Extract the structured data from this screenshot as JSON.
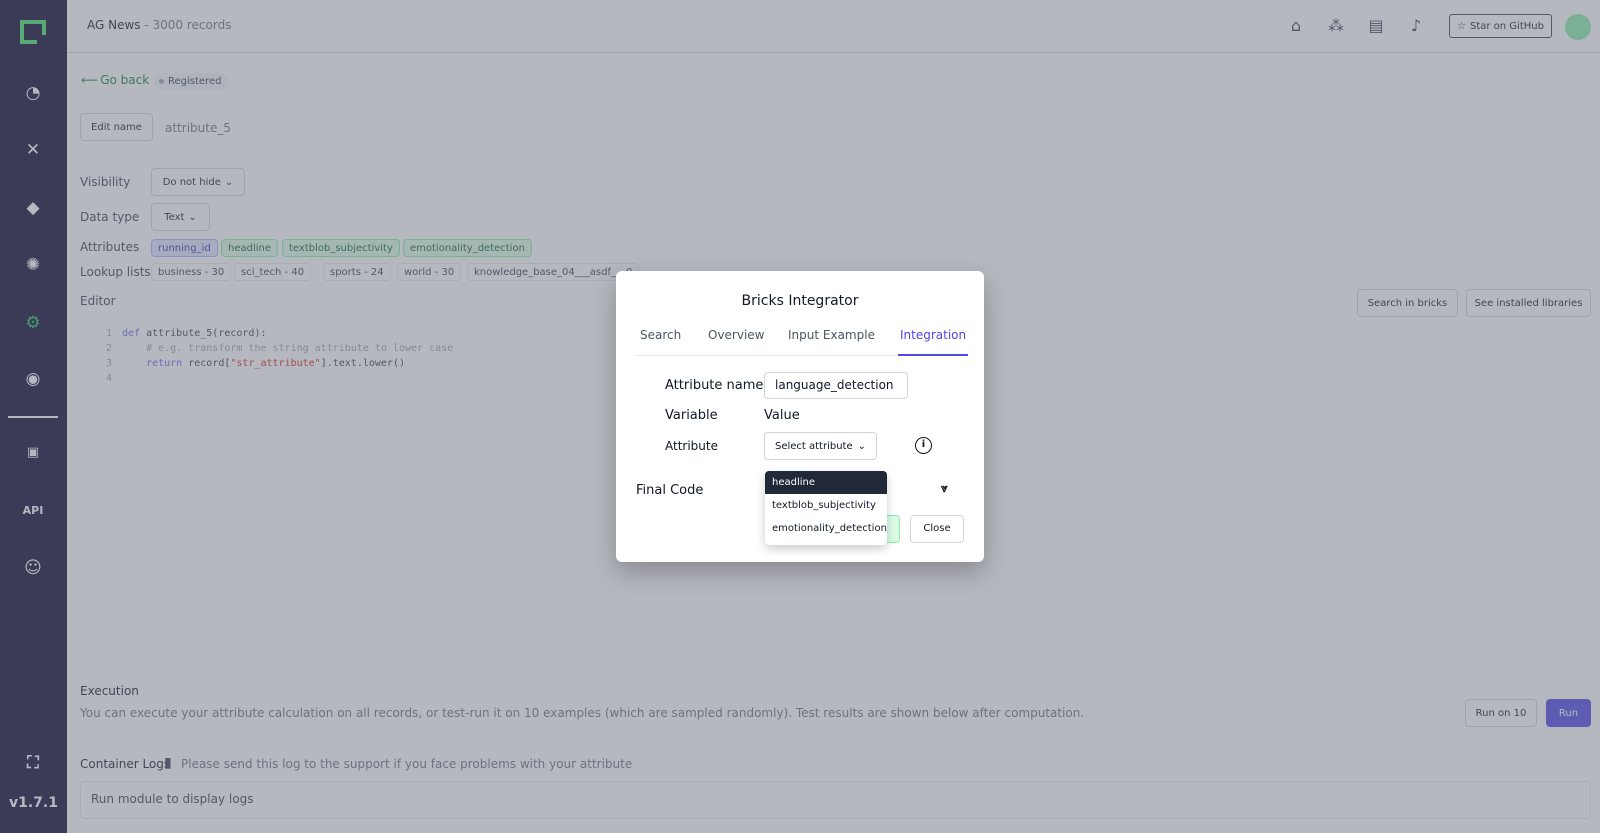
{
  "app": {
    "title": "AG News",
    "subtitle": "- 3000 records",
    "version": "v1.7.1"
  },
  "sidebar": {
    "items": [
      "overview-icon",
      "data-browser-icon",
      "labeling-icon",
      "heuristics-icon",
      "settings-icon",
      "admin-icon",
      "docs-icon",
      "api-icon",
      "discord-icon",
      "fullscreen-icon"
    ]
  },
  "header": {
    "github_label": "Star on GitHub"
  },
  "page": {
    "go_back": "Go back",
    "status": "Registered",
    "edit_name_label": "Edit name",
    "attribute_name": "attribute_5",
    "visibility_label": "Visibility",
    "visibility_value": "Do not hide",
    "data_type_label": "Data type",
    "data_type_value": "Text",
    "attributes_label": "Attributes",
    "attributes": [
      "running_id",
      "headline",
      "textblob_subjectivity",
      "emotionality_detection"
    ],
    "lookup_label": "Lookup lists",
    "lookups": [
      "business - 30",
      "sci_tech - 40",
      "sports - 24",
      "world - 30",
      "knowledge_base_04___asdf_ - 0"
    ],
    "editor_label": "Editor",
    "search_bricks": "Search in bricks",
    "installed_libs": "See installed libraries",
    "code": {
      "l1_kw": "def",
      "l1_rest": " attribute_5(record):",
      "l2": "    # e.g. transform the string attribute to lower case",
      "l3_kw": "    return",
      "l3_a": " record[",
      "l3_str": "\"str_attribute\"",
      "l3_b": "].text.lower()",
      "numbers": [
        "1",
        "2",
        "3",
        "4"
      ]
    },
    "execution_label": "Execution",
    "execution_text": "You can execute your attribute calculation on all records, or test-run it on 10 examples (which are sampled randomly). Test results are shown below after computation.",
    "run_on_10": "Run on 10",
    "run": "Run",
    "logs_label": "Container Logs",
    "logs_hint": "Please send this log to the support if you face problems with your attribute",
    "logs_placeholder": "Run module to display logs"
  },
  "modal": {
    "title": "Bricks Integrator",
    "tabs": [
      "Search",
      "Overview",
      "Input Example",
      "Integration"
    ],
    "active_tab": "Integration",
    "attribute_name_label": "Attribute name",
    "attribute_name_value": "language_detection",
    "variable_header": "Variable",
    "value_header": "Value",
    "attribute_label": "Attribute",
    "select_placeholder": "Select attribute",
    "final_code_label": "Final Code",
    "close": "Close",
    "dropdown_options": [
      "headline",
      "textblob_subjectivity",
      "emotionality_detection"
    ],
    "dropdown_selected": "headline"
  },
  "colors": {
    "sidebar": "#0c052e",
    "accent": "#4f46e5",
    "brand": "#44e26a",
    "run": "#4f46e5"
  }
}
